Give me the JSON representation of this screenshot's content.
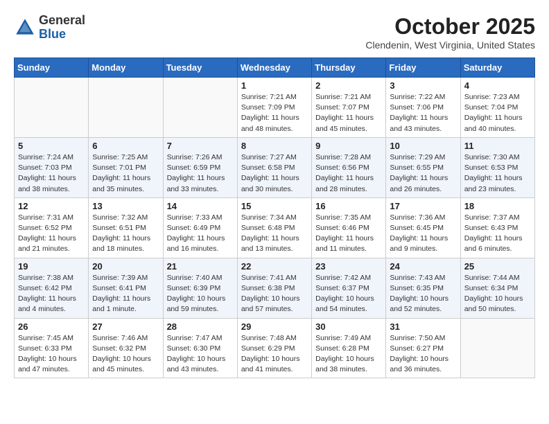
{
  "header": {
    "logo_general": "General",
    "logo_blue": "Blue",
    "month_title": "October 2025",
    "location": "Clendenin, West Virginia, United States"
  },
  "weekdays": [
    "Sunday",
    "Monday",
    "Tuesday",
    "Wednesday",
    "Thursday",
    "Friday",
    "Saturday"
  ],
  "weeks": [
    [
      {
        "day": "",
        "info": ""
      },
      {
        "day": "",
        "info": ""
      },
      {
        "day": "",
        "info": ""
      },
      {
        "day": "1",
        "info": "Sunrise: 7:21 AM\nSunset: 7:09 PM\nDaylight: 11 hours\nand 48 minutes."
      },
      {
        "day": "2",
        "info": "Sunrise: 7:21 AM\nSunset: 7:07 PM\nDaylight: 11 hours\nand 45 minutes."
      },
      {
        "day": "3",
        "info": "Sunrise: 7:22 AM\nSunset: 7:06 PM\nDaylight: 11 hours\nand 43 minutes."
      },
      {
        "day": "4",
        "info": "Sunrise: 7:23 AM\nSunset: 7:04 PM\nDaylight: 11 hours\nand 40 minutes."
      }
    ],
    [
      {
        "day": "5",
        "info": "Sunrise: 7:24 AM\nSunset: 7:03 PM\nDaylight: 11 hours\nand 38 minutes."
      },
      {
        "day": "6",
        "info": "Sunrise: 7:25 AM\nSunset: 7:01 PM\nDaylight: 11 hours\nand 35 minutes."
      },
      {
        "day": "7",
        "info": "Sunrise: 7:26 AM\nSunset: 6:59 PM\nDaylight: 11 hours\nand 33 minutes."
      },
      {
        "day": "8",
        "info": "Sunrise: 7:27 AM\nSunset: 6:58 PM\nDaylight: 11 hours\nand 30 minutes."
      },
      {
        "day": "9",
        "info": "Sunrise: 7:28 AM\nSunset: 6:56 PM\nDaylight: 11 hours\nand 28 minutes."
      },
      {
        "day": "10",
        "info": "Sunrise: 7:29 AM\nSunset: 6:55 PM\nDaylight: 11 hours\nand 26 minutes."
      },
      {
        "day": "11",
        "info": "Sunrise: 7:30 AM\nSunset: 6:53 PM\nDaylight: 11 hours\nand 23 minutes."
      }
    ],
    [
      {
        "day": "12",
        "info": "Sunrise: 7:31 AM\nSunset: 6:52 PM\nDaylight: 11 hours\nand 21 minutes."
      },
      {
        "day": "13",
        "info": "Sunrise: 7:32 AM\nSunset: 6:51 PM\nDaylight: 11 hours\nand 18 minutes."
      },
      {
        "day": "14",
        "info": "Sunrise: 7:33 AM\nSunset: 6:49 PM\nDaylight: 11 hours\nand 16 minutes."
      },
      {
        "day": "15",
        "info": "Sunrise: 7:34 AM\nSunset: 6:48 PM\nDaylight: 11 hours\nand 13 minutes."
      },
      {
        "day": "16",
        "info": "Sunrise: 7:35 AM\nSunset: 6:46 PM\nDaylight: 11 hours\nand 11 minutes."
      },
      {
        "day": "17",
        "info": "Sunrise: 7:36 AM\nSunset: 6:45 PM\nDaylight: 11 hours\nand 9 minutes."
      },
      {
        "day": "18",
        "info": "Sunrise: 7:37 AM\nSunset: 6:43 PM\nDaylight: 11 hours\nand 6 minutes."
      }
    ],
    [
      {
        "day": "19",
        "info": "Sunrise: 7:38 AM\nSunset: 6:42 PM\nDaylight: 11 hours\nand 4 minutes."
      },
      {
        "day": "20",
        "info": "Sunrise: 7:39 AM\nSunset: 6:41 PM\nDaylight: 11 hours\nand 1 minute."
      },
      {
        "day": "21",
        "info": "Sunrise: 7:40 AM\nSunset: 6:39 PM\nDaylight: 10 hours\nand 59 minutes."
      },
      {
        "day": "22",
        "info": "Sunrise: 7:41 AM\nSunset: 6:38 PM\nDaylight: 10 hours\nand 57 minutes."
      },
      {
        "day": "23",
        "info": "Sunrise: 7:42 AM\nSunset: 6:37 PM\nDaylight: 10 hours\nand 54 minutes."
      },
      {
        "day": "24",
        "info": "Sunrise: 7:43 AM\nSunset: 6:35 PM\nDaylight: 10 hours\nand 52 minutes."
      },
      {
        "day": "25",
        "info": "Sunrise: 7:44 AM\nSunset: 6:34 PM\nDaylight: 10 hours\nand 50 minutes."
      }
    ],
    [
      {
        "day": "26",
        "info": "Sunrise: 7:45 AM\nSunset: 6:33 PM\nDaylight: 10 hours\nand 47 minutes."
      },
      {
        "day": "27",
        "info": "Sunrise: 7:46 AM\nSunset: 6:32 PM\nDaylight: 10 hours\nand 45 minutes."
      },
      {
        "day": "28",
        "info": "Sunrise: 7:47 AM\nSunset: 6:30 PM\nDaylight: 10 hours\nand 43 minutes."
      },
      {
        "day": "29",
        "info": "Sunrise: 7:48 AM\nSunset: 6:29 PM\nDaylight: 10 hours\nand 41 minutes."
      },
      {
        "day": "30",
        "info": "Sunrise: 7:49 AM\nSunset: 6:28 PM\nDaylight: 10 hours\nand 38 minutes."
      },
      {
        "day": "31",
        "info": "Sunrise: 7:50 AM\nSunset: 6:27 PM\nDaylight: 10 hours\nand 36 minutes."
      },
      {
        "day": "",
        "info": ""
      }
    ]
  ]
}
